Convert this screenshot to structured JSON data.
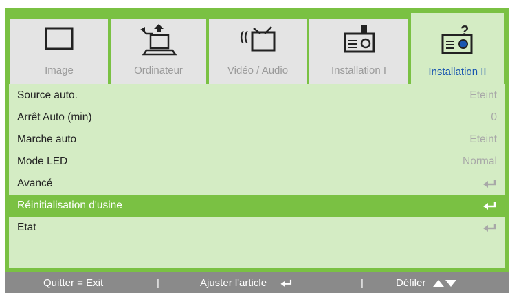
{
  "tabs": [
    {
      "label": "Image",
      "icon": "monitor-icon"
    },
    {
      "label": "Ordinateur",
      "icon": "laptop-icon"
    },
    {
      "label": "Vidéo / Audio",
      "icon": "video-audio-icon"
    },
    {
      "label": "Installation I",
      "icon": "projector-icon"
    },
    {
      "label": "Installation II",
      "icon": "projector-help-icon",
      "active": true
    }
  ],
  "menu": [
    {
      "label": "Source auto.",
      "value": "Eteint"
    },
    {
      "label": "Arrêt Auto (min)",
      "value": "0"
    },
    {
      "label": "Marche auto",
      "value": "Eteint"
    },
    {
      "label": "Mode LED",
      "value": "Normal"
    },
    {
      "label": "Avancé",
      "value": "",
      "icon": "enter-icon"
    },
    {
      "label": "Réinitialisation d'usine",
      "value": "",
      "icon": "enter-icon",
      "selected": true
    },
    {
      "label": "Etat",
      "value": "",
      "icon": "enter-icon"
    }
  ],
  "footer": {
    "quit": "Quitter = Exit",
    "sep1": "|",
    "adjust": "Ajuster l'article",
    "sep2": "|",
    "scroll": "Défiler"
  },
  "colors": {
    "frame": "#7ac143",
    "panel": "#d4ecc4",
    "tab_inactive": "#e4e4e4",
    "active_tab_text": "#1a56b0",
    "footer_bg": "#8a8a8a"
  }
}
